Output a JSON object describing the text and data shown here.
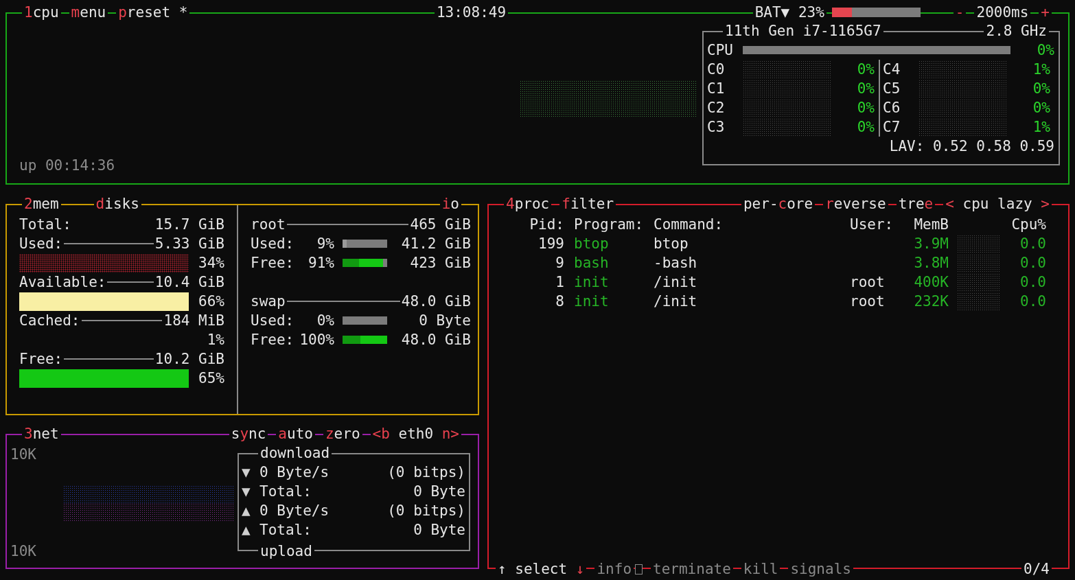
{
  "cpu": {
    "title": [
      [
        {
          "text": "1",
          "hot": true
        },
        {
          "text": "cpu",
          "hot": false
        }
      ],
      [
        {
          "text": "m",
          "hot": true
        },
        {
          "text": "enu",
          "hot": false
        }
      ],
      [
        {
          "text": "p",
          "hot": true
        },
        {
          "text": "reset *",
          "hot": false
        }
      ]
    ],
    "clock": "13:08:49",
    "battery": {
      "label": "BAT▼ 23%",
      "level": 0.23
    },
    "interval": {
      "minus": "-",
      "value": "2000ms",
      "plus": "+"
    },
    "uptime": "up 00:14:36",
    "model": "11th Gen i7-1165G7",
    "freq": "2.8 GHz",
    "total": {
      "label": "CPU",
      "value": "0%",
      "level": 0
    },
    "cores": [
      {
        "label": "C0",
        "value": "0%"
      },
      {
        "label": "C1",
        "value": "0%"
      },
      {
        "label": "C2",
        "value": "0%"
      },
      {
        "label": "C3",
        "value": "0%"
      },
      {
        "label": "C4",
        "value": "1%"
      },
      {
        "label": "C5",
        "value": "0%"
      },
      {
        "label": "C6",
        "value": "0%"
      },
      {
        "label": "C7",
        "value": "1%"
      }
    ],
    "load": "LAV: 0.52 0.58 0.59"
  },
  "mem": {
    "title": [
      {
        "text": "2",
        "hot": true
      },
      {
        "text": "mem",
        "hot": false
      }
    ],
    "rows": [
      {
        "label": "Total:",
        "value": "15.7 GiB",
        "kind": "total"
      },
      {
        "label": "Used:",
        "value": "5.33 GiB",
        "kind": "dotted-graph",
        "color": "#a3202c",
        "percent": "34%"
      },
      {
        "label": "Available:",
        "value": "10.4 GiB",
        "kind": "graph",
        "color": "#f8efa4",
        "percent": "66%"
      },
      {
        "label": "Cached:",
        "value": "184 MiB",
        "kind": "none",
        "percent": "1%"
      },
      {
        "label": "Free:",
        "value": "10.2 GiB",
        "kind": "graph",
        "color": "#14c814",
        "percent": "65%"
      }
    ]
  },
  "disks": {
    "title": [
      {
        "text": "d",
        "hot": true
      },
      {
        "text": "isks",
        "hot": false
      }
    ],
    "io": [
      {
        "text": "i",
        "hot": true
      },
      {
        "text": "o",
        "hot": false
      }
    ],
    "devices": [
      {
        "name": "root",
        "size": "465 GiB",
        "stats": [
          {
            "label": "Used:",
            "percent": "9%",
            "level": 0.09,
            "value": "41.2 GiB",
            "kind": "used"
          },
          {
            "label": "Free:",
            "percent": "91%",
            "level": 0.91,
            "value": "423 GiB",
            "kind": "free"
          }
        ]
      },
      {
        "name": "swap",
        "size": "48.0 GiB",
        "stats": [
          {
            "label": "Used:",
            "percent": "0%",
            "level": 0,
            "value": "0 Byte",
            "kind": "used"
          },
          {
            "label": "Free:",
            "percent": "100%",
            "level": 1,
            "value": "48.0 GiB",
            "kind": "free"
          }
        ]
      }
    ]
  },
  "net": {
    "title": [
      {
        "text": "3",
        "hot": true
      },
      {
        "text": "net",
        "hot": false
      }
    ],
    "buttons": [
      [
        {
          "text": "s",
          "hot": false
        },
        {
          "text": "y",
          "hot": true
        },
        {
          "text": "nc",
          "hot": false
        }
      ],
      [
        {
          "text": "a",
          "hot": true
        },
        {
          "text": "uto",
          "hot": false
        }
      ],
      [
        {
          "text": "z",
          "hot": true
        },
        {
          "text": "ero",
          "hot": false
        }
      ],
      [
        {
          "text": "<b",
          "hot": true
        },
        {
          "text": " eth0 ",
          "hot": false
        },
        {
          "text": "n>",
          "hot": true
        }
      ]
    ],
    "scale_top": "10K",
    "scale_bottom": "10K",
    "box": {
      "title": "download",
      "footer": "upload",
      "rows": [
        {
          "arrow": "▼",
          "label": "0 Byte/s",
          "value": "(0 bitps)"
        },
        {
          "arrow": "▼",
          "label": "Total:",
          "value": "0 Byte"
        },
        {
          "arrow": "▲",
          "label": "0 Byte/s",
          "value": "(0 bitps)"
        },
        {
          "arrow": "▲",
          "label": "Total:",
          "value": "0 Byte"
        }
      ]
    }
  },
  "proc": {
    "title": [
      {
        "text": "4",
        "hot": true
      },
      {
        "text": "proc",
        "hot": false
      }
    ],
    "filter": [
      {
        "text": "f",
        "hot": true
      },
      {
        "text": "ilter",
        "hot": false
      }
    ],
    "buttons": [
      [
        {
          "text": "per-",
          "hot": false
        },
        {
          "text": "c",
          "hot": true
        },
        {
          "text": "ore",
          "hot": false
        }
      ],
      [
        {
          "text": "r",
          "hot": true
        },
        {
          "text": "everse",
          "hot": false
        }
      ],
      [
        {
          "text": "tre",
          "hot": false
        },
        {
          "text": "e",
          "hot": true
        }
      ],
      [
        {
          "text": "<",
          "hot": true
        },
        {
          "text": " cpu lazy ",
          "hot": false
        },
        {
          "text": ">",
          "hot": true
        }
      ]
    ],
    "columns": [
      "Pid:",
      "Program:",
      "Command:",
      "User:",
      "MemB",
      "Cpu%"
    ],
    "rows": [
      {
        "pid": "199",
        "program": "btop",
        "command": "btop",
        "user": "",
        "mem": "3.9M",
        "cpu": "0.0"
      },
      {
        "pid": "9",
        "program": "bash",
        "command": "-bash",
        "user": "",
        "mem": "3.8M",
        "cpu": "0.0"
      },
      {
        "pid": "1",
        "program": "init",
        "command": "/init",
        "user": "root",
        "mem": "400K",
        "cpu": "0.0"
      },
      {
        "pid": "8",
        "program": "init",
        "command": "/init",
        "user": "root",
        "mem": "232K",
        "cpu": "0.0"
      }
    ],
    "footer": [
      {
        "disabled": false,
        "segs": [
          {
            "text": "↑",
            "hot": false
          },
          {
            "text": " select ",
            "hot": false
          },
          {
            "text": "↓",
            "hot": true
          }
        ]
      },
      {
        "disabled": true,
        "segs": [
          {
            "text": "info",
            "hot": false
          }
        ]
      },
      {
        "disabled": true,
        "segs": [
          {
            "text": "terminate",
            "hot": false
          }
        ]
      },
      {
        "disabled": true,
        "segs": [
          {
            "text": "kill",
            "hot": false
          }
        ]
      },
      {
        "disabled": true,
        "segs": [
          {
            "text": "signals",
            "hot": false
          }
        ]
      }
    ],
    "count": "0/4"
  }
}
